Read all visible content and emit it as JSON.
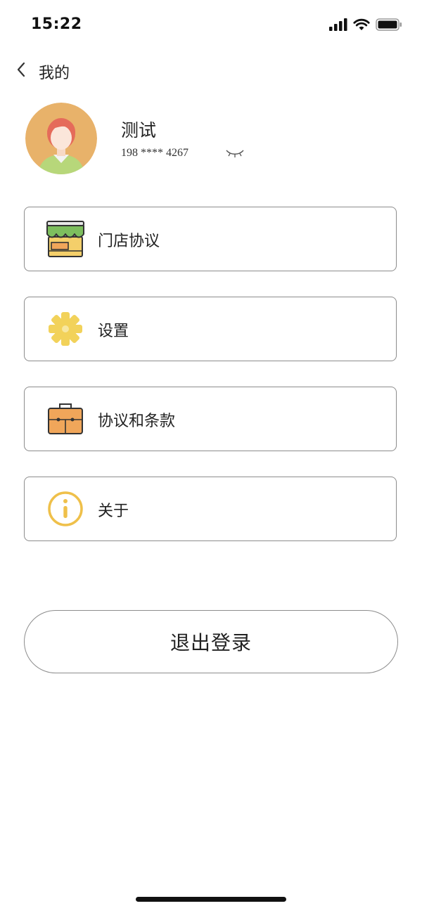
{
  "status_bar": {
    "time": "15:22",
    "icons": [
      "signal-icon",
      "wifi-icon",
      "battery-icon"
    ]
  },
  "header": {
    "back_icon": "chevron-left-icon",
    "title": "我的"
  },
  "profile": {
    "name": "测试",
    "phone": "198 **** 4267",
    "visibility_icon": "eye-closed-icon"
  },
  "menu": {
    "items": [
      {
        "label": "门店协议",
        "icon": "store-icon"
      },
      {
        "label": "设置",
        "icon": "gear-icon"
      },
      {
        "label": "协议和条款",
        "icon": "briefcase-icon"
      },
      {
        "label": "关于",
        "icon": "info-icon"
      }
    ]
  },
  "logout": {
    "label": "退出登录"
  },
  "colors": {
    "avatar_bg": "#E8B26A",
    "card_border": "#8C8C8C",
    "icon_orange": "#F0A65A",
    "icon_yellow": "#F2D25A",
    "icon_green": "#7DBE5E"
  }
}
